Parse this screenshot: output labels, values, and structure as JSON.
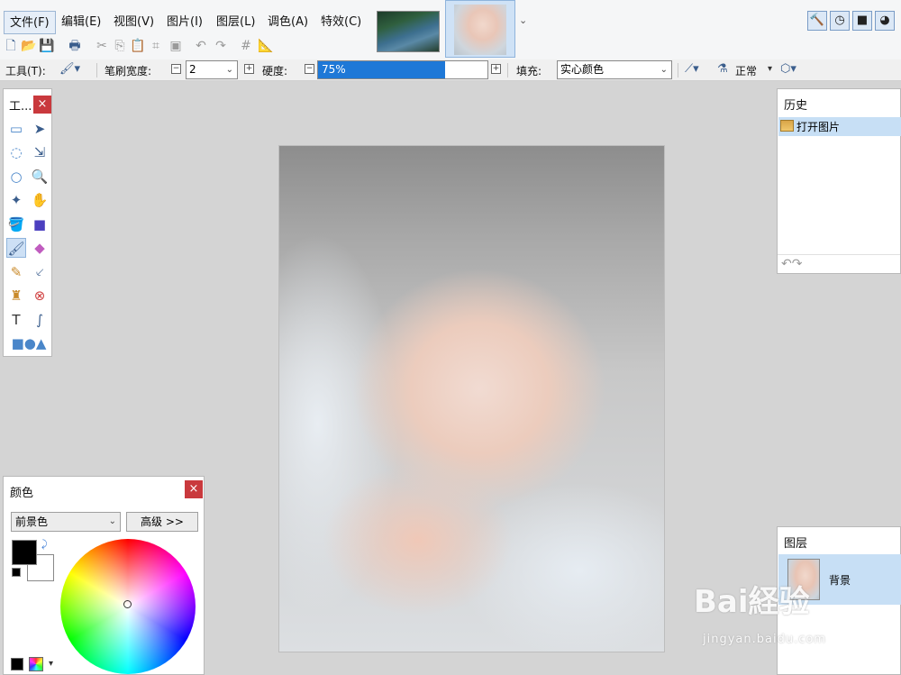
{
  "menu": [
    {
      "label": "文件(F)",
      "active": true
    },
    {
      "label": "编辑(E)"
    },
    {
      "label": "视图(V)"
    },
    {
      "label": "图片(I)"
    },
    {
      "label": "图层(L)"
    },
    {
      "label": "调色(A)"
    },
    {
      "label": "特效(C)"
    }
  ],
  "options": {
    "tool_label": "工具(T):",
    "brush_width_label": "笔刷宽度:",
    "brush_width_value": "2",
    "hardness_label": "硬度:",
    "hardness_value": "75%",
    "hardness_fraction": 0.75,
    "fill_label": "填充:",
    "fill_value": "实心颜色",
    "blend_mode": "正常"
  },
  "tools_panel": {
    "title": "工..."
  },
  "history_panel": {
    "title": "历史",
    "item": "打开图片"
  },
  "layers_panel": {
    "title": "图层",
    "layer_name": "背景"
  },
  "colors_panel": {
    "title": "颜色",
    "mode": "前景色",
    "advanced_label": "高级 >>",
    "primary_color": "#000000",
    "secondary_color": "#ffffff"
  },
  "watermark": {
    "logo": "Bai経验",
    "url": "jingyan.baidu.com"
  },
  "colors": {
    "accent": "#1e78d7",
    "close": "#c9393d",
    "selection": "#c7dff5"
  }
}
